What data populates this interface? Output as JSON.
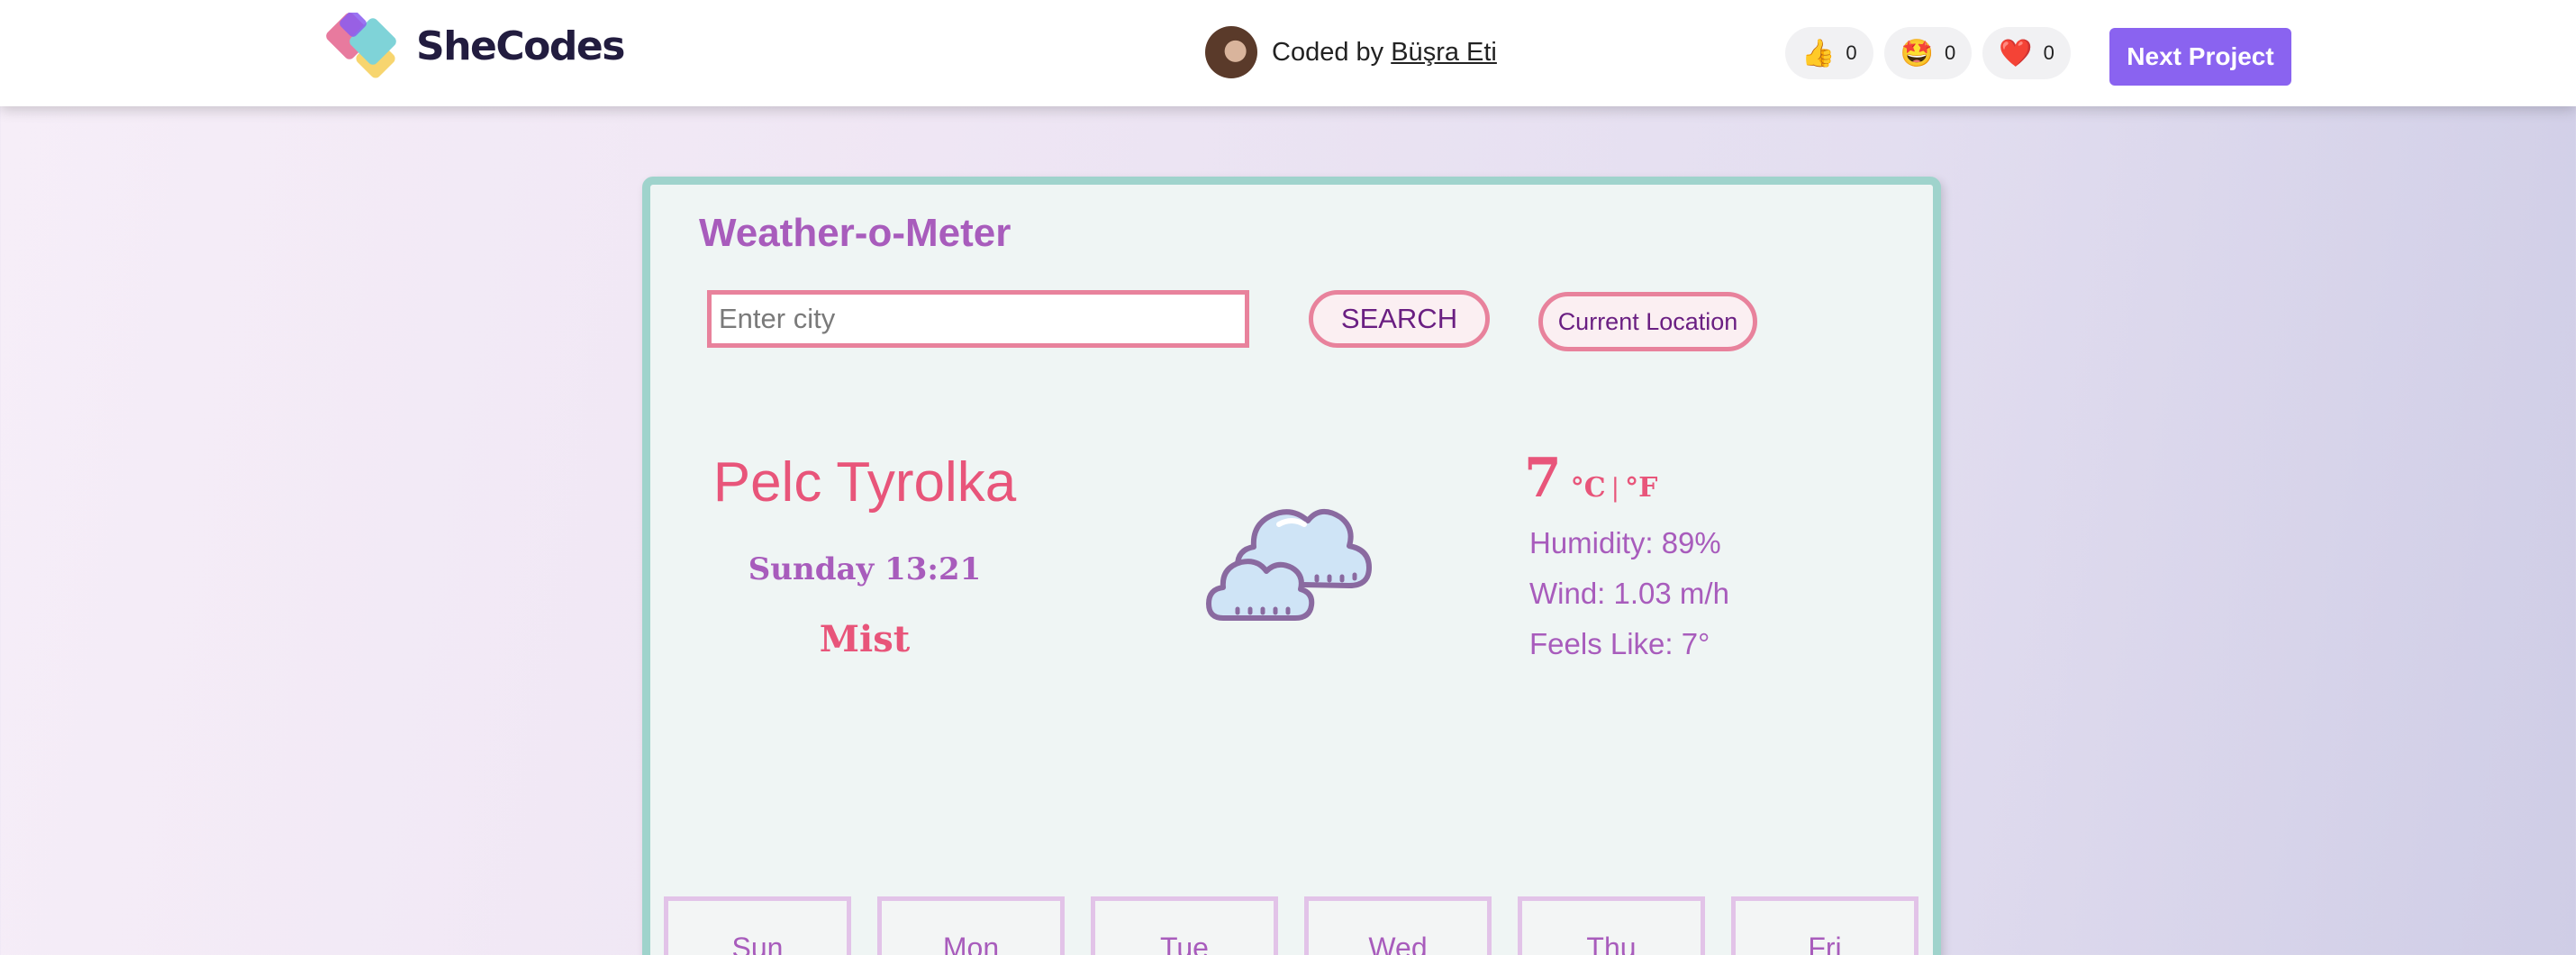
{
  "header": {
    "brand": "SheCodes",
    "coded_by_prefix": "Coded by",
    "author_name": "Büşra Eti",
    "reactions": [
      {
        "icon": "thumbs-up-icon",
        "emoji": "👍",
        "count": "0"
      },
      {
        "icon": "star-struck-icon",
        "emoji": "🤩",
        "count": "0"
      },
      {
        "icon": "heart-icon",
        "emoji": "❤️",
        "count": "0"
      }
    ],
    "next_project_label": "Next Project"
  },
  "app": {
    "title": "Weather-o-Meter",
    "search": {
      "placeholder": "Enter city",
      "value": ""
    },
    "search_button": "SEARCH",
    "current_location_button": "Current Location"
  },
  "current": {
    "city": "Pelc Tyrolka",
    "datetime": "Sunday 13:21",
    "condition": "Mist",
    "icon": "cloudy-icon",
    "temperature": "7",
    "unit_celsius": "°C",
    "unit_separator": "|",
    "unit_fahrenheit": "°F",
    "humidity": "Humidity: 89%",
    "wind": "Wind: 1.03 m/h",
    "feels_like": "Feels Like: 7°"
  },
  "forecast": {
    "days": [
      "Sun",
      "Mon",
      "Tue",
      "Wed",
      "Thu",
      "Fri"
    ]
  },
  "colors": {
    "accent_purple": "#a85cbc",
    "accent_pink": "#e8557a",
    "card_border": "#9fd3cc",
    "button_border": "#e8829c",
    "next_button": "#8a63f0"
  }
}
